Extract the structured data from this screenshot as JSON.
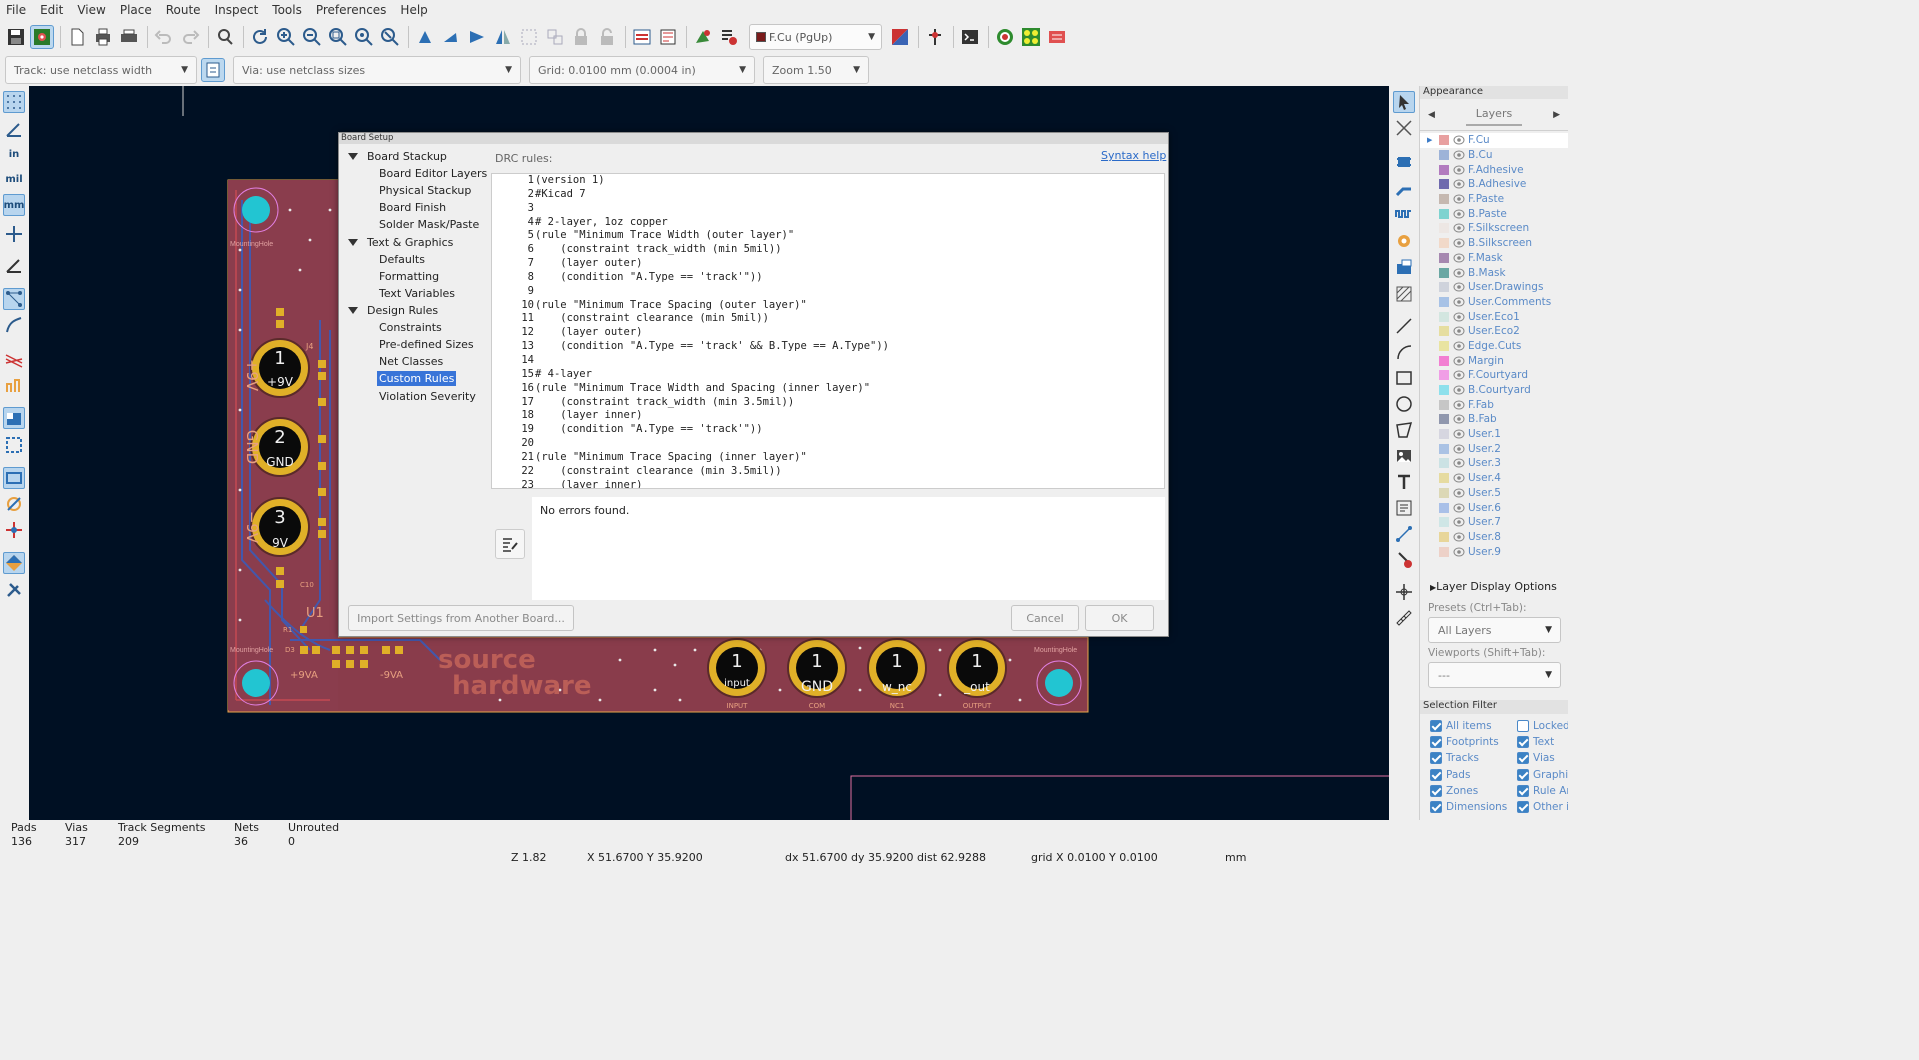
{
  "menu": [
    "File",
    "Edit",
    "View",
    "Place",
    "Route",
    "Inspect",
    "Tools",
    "Preferences",
    "Help"
  ],
  "toolbar": {
    "layer": "F.Cu (PgUp)"
  },
  "toolbar2": {
    "track": "Track: use netclass width",
    "via": "Via: use netclass sizes",
    "grid": "Grid: 0.0100 mm (0.0004 in)",
    "zoom": "Zoom 1.50"
  },
  "left_units": {
    "in": "in",
    "mil": "mil",
    "mm": "mm"
  },
  "pcb": {
    "pads_top": [
      "1",
      "2",
      "3"
    ],
    "pads_top_sub": [
      "+9V",
      "GND",
      "9V"
    ],
    "silk_left": [
      "+9V",
      "GND",
      "−9V"
    ],
    "pads_bottom": [
      "1",
      "1",
      "1",
      "1"
    ],
    "pads_bottom_sub": [
      "input",
      "GND",
      "w_nc",
      "_out"
    ],
    "bottom_labels": [
      "INPUT",
      "COM",
      "NC1",
      "OUTPUT"
    ],
    "u1": "U1",
    "j4": "J4",
    "c10": "C10",
    "r1": "R1",
    "mounting": "MountingHole",
    "pwr_left": "+9VA",
    "pwr_right": "-9VA",
    "logo1": "source",
    "logo2": "hardware",
    "d3": "D3"
  },
  "dialog": {
    "title": "Board Setup",
    "drc_label": "DRC rules:",
    "syntax_help": "Syntax help",
    "no_errors": "No errors found.",
    "import_btn": "Import Settings from Another Board...",
    "cancel": "Cancel",
    "ok": "OK",
    "tree": {
      "board_stackup": "Board Stackup",
      "board_editor_layers": "Board Editor Layers",
      "physical_stackup": "Physical Stackup",
      "board_finish": "Board Finish",
      "solder_mask": "Solder Mask/Paste",
      "text_graphics": "Text & Graphics",
      "defaults": "Defaults",
      "formatting": "Formatting",
      "text_variables": "Text Variables",
      "design_rules": "Design Rules",
      "constraints": "Constraints",
      "predefined_sizes": "Pre-defined Sizes",
      "net_classes": "Net Classes",
      "custom_rules": "Custom Rules",
      "violation_severity": "Violation Severity"
    },
    "line_numbers": "1\n2\n3\n4\n5\n6\n7\n8\n9\n10\n11\n12\n13\n14\n15\n16\n17\n18\n19\n20\n21\n22\n23",
    "code": "(version 1)\n#Kicad 7\n\n# 2-layer, 1oz copper\n(rule \"Minimum Trace Width (outer layer)\"\n    (constraint track_width (min 5mil))\n    (layer outer)\n    (condition \"A.Type == 'track'\"))\n\n(rule \"Minimum Trace Spacing (outer layer)\"\n    (constraint clearance (min 5mil))\n    (layer outer)\n    (condition \"A.Type == 'track' && B.Type == A.Type\"))\n\n# 4-layer\n(rule \"Minimum Trace Width and Spacing (inner layer)\"\n    (constraint track_width (min 3.5mil))\n    (layer inner)\n    (condition \"A.Type == 'track'\"))\n\n(rule \"Minimum Trace Spacing (inner layer)\"\n    (constraint clearance (min 3.5mil))\n    (layer inner)"
  },
  "appearance": {
    "title": "Appearance",
    "tab": "Layers",
    "layer_display": "Layer Display Options",
    "presets_label": "Presets (Ctrl+Tab):",
    "presets_value": "All Layers",
    "viewports_label": "Viewports (Shift+Tab):",
    "viewports_value": "---",
    "layers": [
      {
        "name": "F.Cu",
        "color": "#e8a0a0"
      },
      {
        "name": "B.Cu",
        "color": "#9db3d8"
      },
      {
        "name": "F.Adhesive",
        "color": "#b27bbf"
      },
      {
        "name": "B.Adhesive",
        "color": "#6f6aae"
      },
      {
        "name": "F.Paste",
        "color": "#c5b8b0"
      },
      {
        "name": "B.Paste",
        "color": "#7ed3d0"
      },
      {
        "name": "F.Silkscreen",
        "color": "#ede7e4"
      },
      {
        "name": "B.Silkscreen",
        "color": "#f1d9c9"
      },
      {
        "name": "F.Mask",
        "color": "#a688b0"
      },
      {
        "name": "B.Mask",
        "color": "#6aa7a3"
      },
      {
        "name": "User.Drawings",
        "color": "#cfd3dc"
      },
      {
        "name": "User.Comments",
        "color": "#a7c2e6"
      },
      {
        "name": "User.Eco1",
        "color": "#d3e6e0"
      },
      {
        "name": "User.Eco2",
        "color": "#e6dea0"
      },
      {
        "name": "Edge.Cuts",
        "color": "#e9e4a1"
      },
      {
        "name": "Margin",
        "color": "#f27fd2"
      },
      {
        "name": "F.Courtyard",
        "color": "#f09ee6"
      },
      {
        "name": "B.Courtyard",
        "color": "#8ee0ec"
      },
      {
        "name": "F.Fab",
        "color": "#c6c6c6"
      },
      {
        "name": "B.Fab",
        "color": "#9097ad"
      },
      {
        "name": "User.1",
        "color": "#d6d6e0"
      },
      {
        "name": "User.2",
        "color": "#aac2e4"
      },
      {
        "name": "User.3",
        "color": "#cbe2e4"
      },
      {
        "name": "User.4",
        "color": "#e6dba0"
      },
      {
        "name": "User.5",
        "color": "#dcd8b6"
      },
      {
        "name": "User.6",
        "color": "#a9c0e8"
      },
      {
        "name": "User.7",
        "color": "#cfe6e6"
      },
      {
        "name": "User.8",
        "color": "#e8d69a"
      },
      {
        "name": "User.9",
        "color": "#edd1c8"
      }
    ],
    "selection_filter": "Selection Filter",
    "filters": {
      "all_items": "All items",
      "locked": "Locked",
      "footprints": "Footprints",
      "text": "Text",
      "tracks": "Tracks",
      "vias": "Vias",
      "pads": "Pads",
      "graphics": "Graphics",
      "zones": "Zones",
      "rule_areas": "Rule Areas",
      "dimensions": "Dimensions",
      "other": "Other items"
    }
  },
  "status": {
    "pads_label": "Pads",
    "pads": "136",
    "vias_label": "Vias",
    "vias": "317",
    "tracks_label": "Track Segments",
    "tracks": "209",
    "nets_label": "Nets",
    "nets": "36",
    "unrouted_label": "Unrouted",
    "unrouted": "0",
    "zoom": "Z 1.82",
    "xy": "X 51.6700  Y 35.9200",
    "dist": "dx 51.6700  dy 35.9200  dist 62.9288",
    "grid": "grid X 0.0100  Y 0.0100",
    "units": "mm"
  }
}
